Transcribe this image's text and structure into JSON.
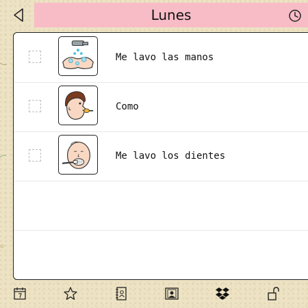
{
  "header": {
    "title": "Lunes"
  },
  "tasks": [
    {
      "label": "Me lavo las manos",
      "checked": false,
      "pictogram": "wash-hands"
    },
    {
      "label": "Como",
      "checked": false,
      "pictogram": "eat"
    },
    {
      "label": "Me lavo los dientes",
      "checked": false,
      "pictogram": "brush-teeth"
    }
  ],
  "toolbar": {
    "icons": [
      "calendar-icon",
      "star-icon",
      "contacts-book-icon",
      "portrait-icon",
      "dropbox-icon",
      "unlock-icon"
    ]
  },
  "colors": {
    "background": "#ede3c4",
    "title_bar": "#f8bcc7"
  }
}
